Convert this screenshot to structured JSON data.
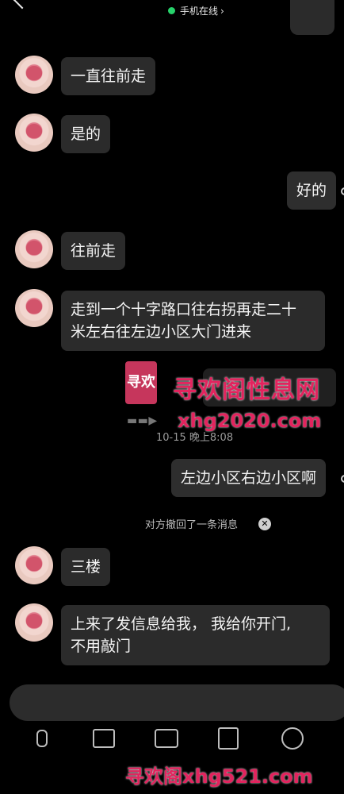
{
  "header": {
    "status_text": "手机在线",
    "status_chevron": "›",
    "status_color": "#27d36b"
  },
  "messages": [
    {
      "side": "left",
      "text": "一直往前走"
    },
    {
      "side": "left",
      "text": "是的"
    },
    {
      "side": "right",
      "text": "好的"
    },
    {
      "side": "left",
      "text": "往前走"
    },
    {
      "side": "left",
      "line1": "走到一个十字路口往右拐再走二十",
      "line2": "米左右往左边小区大门进来"
    },
    {
      "side": "right",
      "text": "左边小区右边小区啊"
    },
    {
      "side": "left",
      "text": "三楼"
    },
    {
      "side": "left",
      "line1": "上来了发信息给我， 我给你开门,",
      "line2": "不用敲门"
    }
  ],
  "timestamp": "10-15 晚上8:08",
  "recall_notice": "对方撤回了一条消息",
  "watermarks": {
    "logo_text": "寻欢",
    "site_name": "寻欢阁性息网",
    "site_domain": "xhg2020.com",
    "bottom_line": "寻欢阁xhg521.com",
    "color": "#e2245e"
  },
  "icons": {
    "voice": "microphone-icon",
    "image": "image-icon",
    "camera": "camera-icon",
    "red_packet": "red-packet-icon",
    "emoji": "emoji-icon"
  }
}
